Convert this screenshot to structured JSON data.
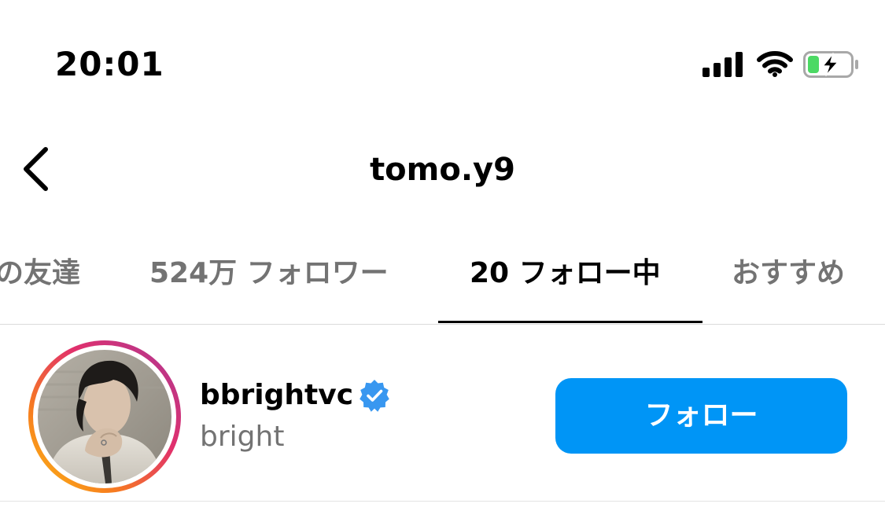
{
  "status_bar": {
    "time": "20:01",
    "icons": [
      "signal-icon",
      "wifi-icon",
      "battery-charging-icon"
    ],
    "battery_color": "#4cd964"
  },
  "header": {
    "back_icon": "chevron-left-icon",
    "title": "tomo.y9"
  },
  "tabs": [
    {
      "label": "の友達",
      "active": false
    },
    {
      "label": "524万 フォロワー",
      "active": false
    },
    {
      "label": "20 フォロー中",
      "active": true
    },
    {
      "label": "おすすめ",
      "active": false
    }
  ],
  "following_list": [
    {
      "username": "bbrightvc",
      "verified": true,
      "full_name": "bright",
      "has_story": true,
      "button_label": "フォロー"
    }
  ],
  "colors": {
    "accent": "#0095f6",
    "verified": "#3897f0",
    "secondary_text": "#737373"
  }
}
